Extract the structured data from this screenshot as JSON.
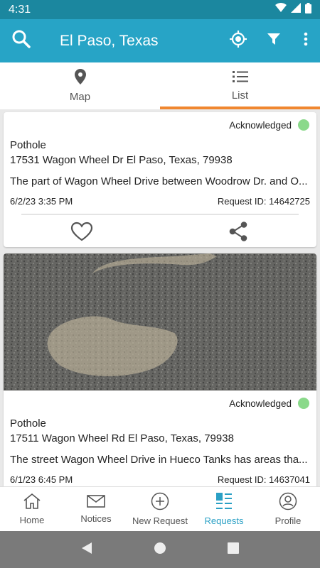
{
  "status_bar": {
    "time": "4:31"
  },
  "app_bar": {
    "title": "El Paso, Texas"
  },
  "tabs": [
    {
      "label": "Map",
      "icon": "map-pin-icon",
      "active": false
    },
    {
      "label": "List",
      "icon": "list-icon",
      "active": true
    }
  ],
  "requests": [
    {
      "status": "Acknowledged",
      "status_color": "#8ad98a",
      "category": "Pothole",
      "address": "17531 Wagon Wheel Dr El Paso, Texas, 79938",
      "description": "The part of Wagon Wheel Drive between Woodrow Dr. and O...",
      "date": "6/2/23 3:35 PM",
      "request_id": "Request ID: 14642725"
    },
    {
      "status": "Acknowledged",
      "status_color": "#8ad98a",
      "category": "Pothole",
      "address": "17511 Wagon Wheel Rd El Paso, Texas, 79938",
      "description": "The street Wagon Wheel Drive in Hueco Tanks has areas tha...",
      "date": "6/1/23 6:45 PM",
      "request_id": "Request ID: 14637041"
    }
  ],
  "bottom_nav": [
    {
      "label": "Home",
      "icon": "home-icon",
      "active": false
    },
    {
      "label": "Notices",
      "icon": "mail-icon",
      "active": false
    },
    {
      "label": "New Request",
      "icon": "plus-circle-icon",
      "active": false
    },
    {
      "label": "Requests",
      "icon": "requests-icon",
      "active": true
    },
    {
      "label": "Profile",
      "icon": "profile-icon",
      "active": false
    }
  ],
  "colors": {
    "primary": "#27a4c6",
    "status_bar": "#1b879f",
    "tab_indicator": "#f0872f",
    "active_nav": "#2aa0c5"
  }
}
